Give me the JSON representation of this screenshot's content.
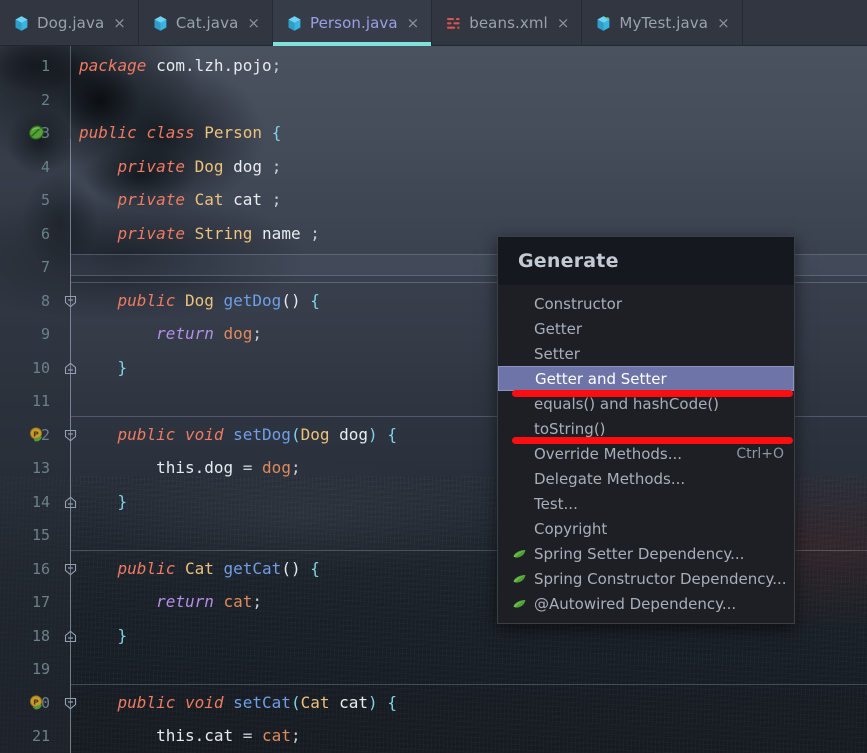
{
  "tabs": [
    {
      "label": "Dog.java",
      "icon": "java-class-icon",
      "active": false,
      "close": "×"
    },
    {
      "label": "Cat.java",
      "icon": "java-class-icon",
      "active": false,
      "close": "×"
    },
    {
      "label": "Person.java",
      "icon": "java-class-icon",
      "active": true,
      "close": "×"
    },
    {
      "label": "beans.xml",
      "icon": "xml-file-icon",
      "active": false,
      "close": "×"
    },
    {
      "label": "MyTest.java",
      "icon": "java-test-class-icon",
      "active": false,
      "close": "×"
    }
  ],
  "editor": {
    "file": "Person.java",
    "caret_line": 7,
    "line_numbers": [
      1,
      2,
      3,
      4,
      5,
      6,
      7,
      8,
      9,
      10,
      11,
      12,
      13,
      14,
      15,
      16,
      17,
      18,
      19,
      20,
      21
    ],
    "gutter_markers": [
      {
        "line": 3,
        "icon": "spring-bean-icon"
      },
      {
        "line": 12,
        "icon": "spring-property-icon"
      },
      {
        "line": 20,
        "icon": "spring-property-icon"
      }
    ],
    "lines": [
      {
        "n": 1,
        "text": "package com.lzh.pojo;"
      },
      {
        "n": 2,
        "text": ""
      },
      {
        "n": 3,
        "text": "public class Person {"
      },
      {
        "n": 4,
        "text": "    private Dog dog ;"
      },
      {
        "n": 5,
        "text": "    private Cat cat ;"
      },
      {
        "n": 6,
        "text": "    private String name ;"
      },
      {
        "n": 7,
        "text": ""
      },
      {
        "n": 8,
        "text": "    public Dog getDog() {"
      },
      {
        "n": 9,
        "text": "        return dog;"
      },
      {
        "n": 10,
        "text": "    }"
      },
      {
        "n": 11,
        "text": ""
      },
      {
        "n": 12,
        "text": "    public void setDog(Dog dog) {"
      },
      {
        "n": 13,
        "text": "        this.dog = dog;"
      },
      {
        "n": 14,
        "text": "    }"
      },
      {
        "n": 15,
        "text": ""
      },
      {
        "n": 16,
        "text": "    public Cat getCat() {"
      },
      {
        "n": 17,
        "text": "        return cat;"
      },
      {
        "n": 18,
        "text": "    }"
      },
      {
        "n": 19,
        "text": ""
      },
      {
        "n": 20,
        "text": "    public void setCat(Cat cat) {"
      },
      {
        "n": 21,
        "text": "        this.cat = cat;"
      }
    ]
  },
  "generate_popup": {
    "title": "Generate",
    "items": [
      {
        "label": "Constructor",
        "icon": "none",
        "shortcut": "",
        "selected": false
      },
      {
        "label": "Getter",
        "icon": "none",
        "shortcut": "",
        "selected": false
      },
      {
        "label": "Setter",
        "icon": "none",
        "shortcut": "",
        "selected": false
      },
      {
        "label": "Getter and Setter",
        "icon": "none",
        "shortcut": "",
        "selected": true
      },
      {
        "label": "equals() and hashCode()",
        "icon": "none",
        "shortcut": "",
        "selected": false
      },
      {
        "label": "toString()",
        "icon": "none",
        "shortcut": "",
        "selected": false
      },
      {
        "label": "Override Methods...",
        "icon": "none",
        "shortcut": "Ctrl+O",
        "selected": false
      },
      {
        "label": "Delegate Methods...",
        "icon": "none",
        "shortcut": "",
        "selected": false
      },
      {
        "label": "Test...",
        "icon": "none",
        "shortcut": "",
        "selected": false
      },
      {
        "label": "Copyright",
        "icon": "none",
        "shortcut": "",
        "selected": false
      },
      {
        "label": "Spring Setter Dependency...",
        "icon": "spring-leaf-icon",
        "shortcut": "",
        "selected": false
      },
      {
        "label": "Spring Constructor Dependency...",
        "icon": "spring-leaf-icon",
        "shortcut": "",
        "selected": false
      },
      {
        "label": "@Autowired Dependency...",
        "icon": "spring-leaf-icon",
        "shortcut": "",
        "selected": false
      }
    ]
  },
  "annotations": [
    {
      "name": "red-underline-getter-and-setter",
      "shape": "line",
      "color": "#fb0d10"
    },
    {
      "name": "red-underline-tostring",
      "shape": "line",
      "color": "#fb0d10"
    }
  ],
  "colors": {
    "tab_active_underline": "#81e2dc",
    "tab_active_text": "#9a9fe6",
    "menu_selection": "#6e73a8",
    "annotation_red": "#fb0d10",
    "spring_green": "#4f9e36"
  }
}
